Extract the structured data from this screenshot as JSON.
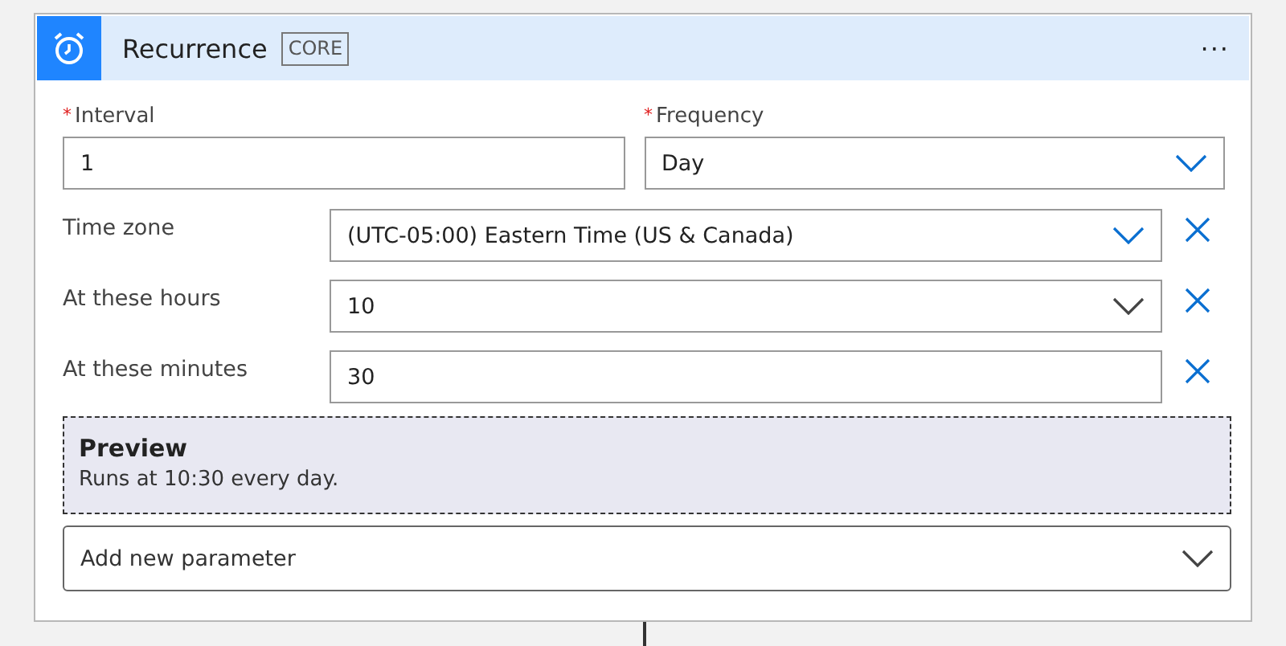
{
  "card": {
    "title": "Recurrence",
    "badge": "CORE",
    "menu": "···"
  },
  "required_fields": [
    {
      "label": "Interval",
      "required_mark": "*",
      "kind": "text",
      "value": "1"
    },
    {
      "label": "Frequency",
      "required_mark": "*",
      "kind": "dropdown",
      "value": "Day",
      "accent": true
    }
  ],
  "parameters": [
    {
      "label": "Time zone",
      "kind": "dropdown",
      "value": "(UTC-05:00) Eastern Time (US & Canada)",
      "accent": true,
      "removable": true
    },
    {
      "label": "At these hours",
      "kind": "dropdown",
      "value": "10",
      "accent": false,
      "removable": true
    },
    {
      "label": "At these minutes",
      "kind": "text",
      "value": "30",
      "removable": true
    }
  ],
  "preview": {
    "title": "Preview",
    "text": "Runs at 10:30 every day."
  },
  "add_parameter": {
    "placeholder": "Add new parameter",
    "accent": false
  }
}
